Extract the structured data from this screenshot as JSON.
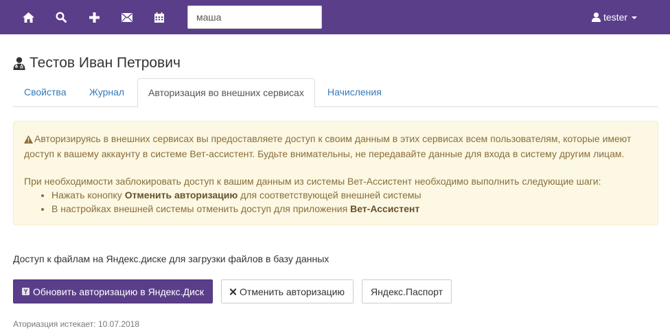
{
  "navbar": {
    "search_value": "маша",
    "user": "tester",
    "bg_color": "#5b3e8a",
    "icons": [
      "home-icon",
      "search-icon",
      "plus-icon",
      "envelope-icon",
      "calendar-icon"
    ]
  },
  "page": {
    "title": "Тестов Иван Петрович",
    "title_icon": "user-md-icon"
  },
  "tabs": [
    {
      "label": "Свойства",
      "active": false
    },
    {
      "label": "Журнал",
      "active": false
    },
    {
      "label": "Авторизация во внешних сервисах",
      "active": true
    },
    {
      "label": "Начисления",
      "active": false
    }
  ],
  "alert": {
    "icon": "warning-icon",
    "paragraph1": "Авторизируясь в внешних сервисах вы предоставляете доступ к своим данным в этих сервисах всем пользователям, которые имеют доступ к вашему аккаунту в системе Вет-ассистент. Будьте внимательны, не передавайте данные для входа в систему другим лицам.",
    "paragraph2": "При необходимости заблокировать доступ к вашим данным из системы Вет-Ассистент необходимо выполнить следующие шаги:",
    "steps": [
      {
        "before": "Нажать конопку ",
        "bold": "Отменить авторизацию",
        "after": " для соответствующей внешней системы"
      },
      {
        "before": "В настройках внешней системы отменить доступ для приложения ",
        "bold": "Вет-Ассистент",
        "after": ""
      }
    ]
  },
  "yandex": {
    "description": "Доступ к файлам на Яндекс.диске для загрузки файлов в базу данных",
    "refresh_label": "Обновить авторизацию в Яндекс.Диск",
    "cancel_label": "Отменить авторизацию",
    "passport_label": "Яндекс.Паспорт",
    "expires": "Аториазция истекает: 10.07.2018"
  }
}
